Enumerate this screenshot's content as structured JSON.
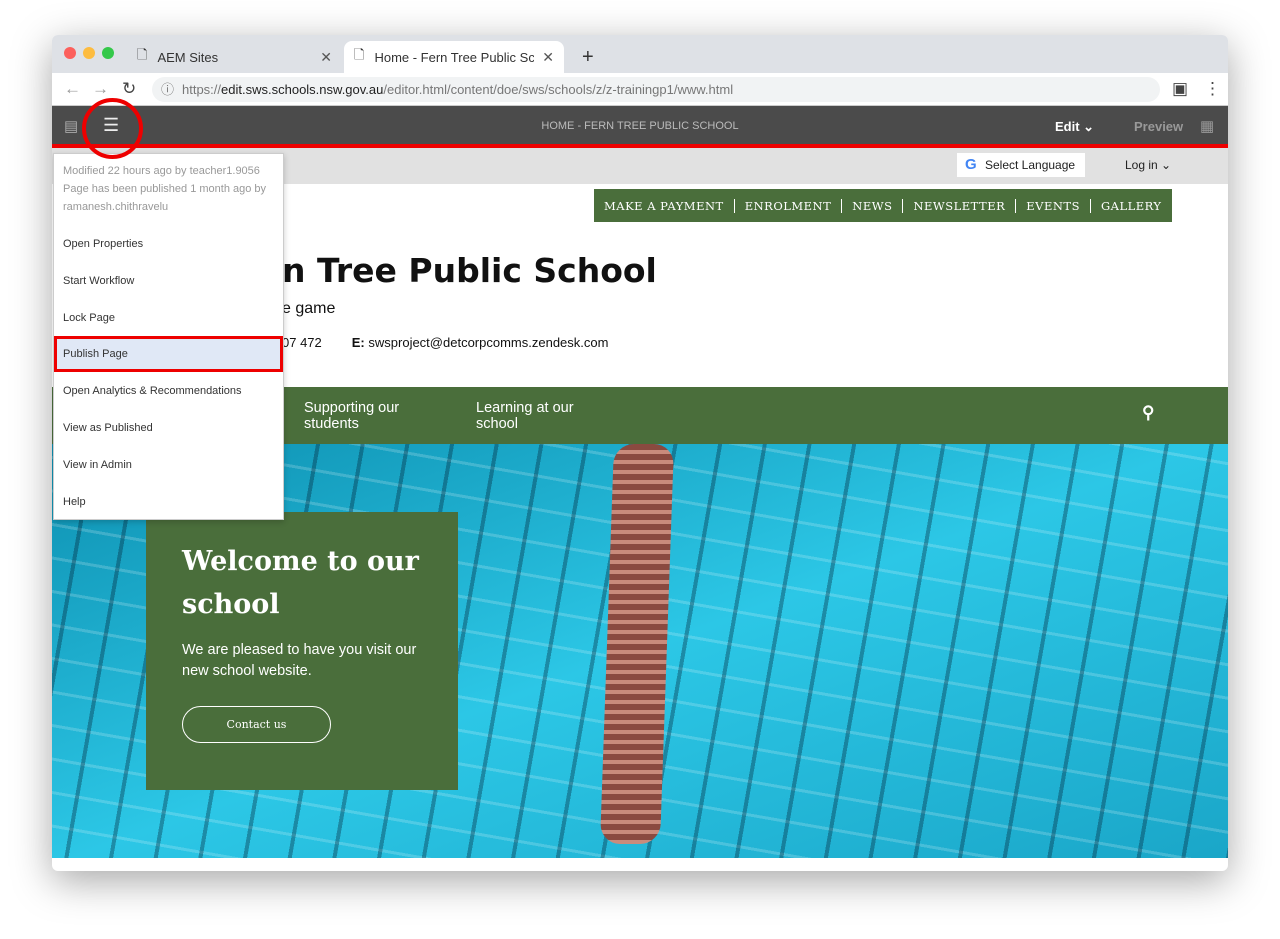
{
  "browser": {
    "tabs": [
      {
        "label": "AEM Sites"
      },
      {
        "label": "Home - Fern Tree Public Schoo"
      }
    ],
    "url_prefix": "https://",
    "url_host": "edit.sws.schools.nsw.gov.au",
    "url_path": "/editor.html/content/doe/sws/schools/z/z-trainingp1/www.html"
  },
  "aem": {
    "title": "HOME - FERN TREE PUBLIC SCHOOL",
    "edit": "Edit",
    "preview": "Preview"
  },
  "menu": {
    "meta": [
      "Modified 22 hours ago by teacher1.9056",
      "Page has been published 1 month ago by",
      "ramanesh.chithravelu"
    ],
    "items": [
      "Open Properties",
      "Start Workflow",
      "Lock Page",
      "Publish Page",
      "Open Analytics & Recommendations",
      "View as Published",
      "View in Admin",
      "Help"
    ],
    "highlighted": "Publish Page"
  },
  "site": {
    "select_language": "Select Language",
    "login": "Log in",
    "topnav": [
      "MAKE A PAYMENT",
      "ENROLMENT",
      "NEWS",
      "NEWSLETTER",
      "EVENTS",
      "GALLERY"
    ],
    "title": "n Tree Public School",
    "subtitle": "e game",
    "phone": "07 472",
    "email_label": "E:",
    "email": "swsproject@detcorpcomms.zendesk.com",
    "mainnav": [
      "Supporting our students",
      "Learning at our school"
    ],
    "welcome": {
      "heading": "Welcome to our school",
      "text": "We are pleased to have you visit our new school website.",
      "button": "Contact us"
    }
  },
  "colors": {
    "accent": "#e00000",
    "green": "#4a6e3b",
    "toolbar": "#4b4b4b"
  }
}
